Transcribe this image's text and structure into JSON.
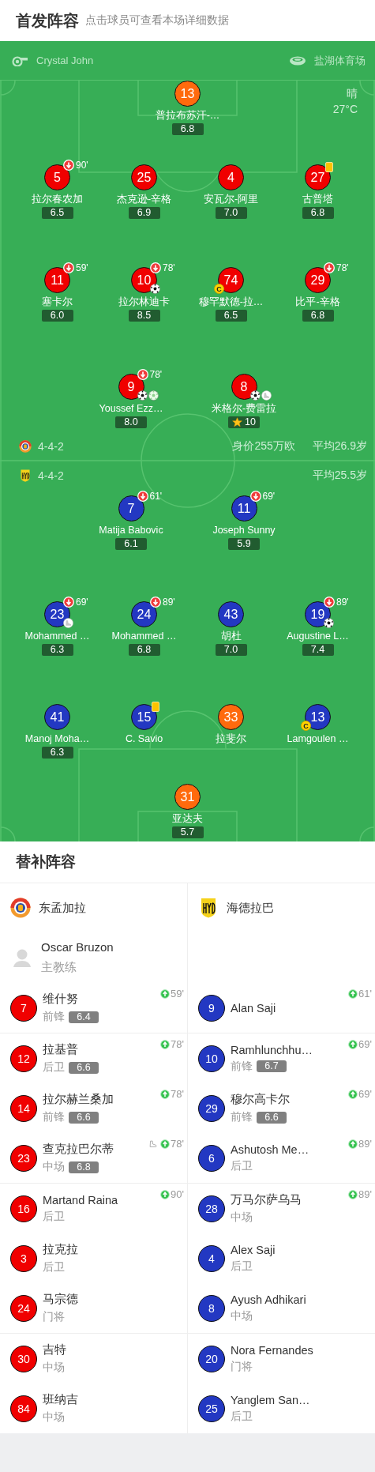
{
  "header": {
    "title": "首发阵容",
    "subtitle": "点击球员可查看本场详细数据"
  },
  "match_info": {
    "referee": "Crystal John",
    "venue": "盐湖体育场",
    "weather": "晴",
    "temperature": "27°C"
  },
  "home": {
    "formation": "4-4-2",
    "value": "身价255万欧",
    "avg_age": "平均26.9岁",
    "lines": [
      {
        "players": [
          {
            "number": "13",
            "name": "普拉布苏汗-…",
            "rating": "6.8",
            "color": "#ff6a0d",
            "yellow_card": false,
            "mvp": false
          }
        ]
      },
      {
        "players": [
          {
            "number": "5",
            "name": "拉尔春农加",
            "rating": "6.5",
            "color": "#f00000",
            "sub_off": "90'",
            "yellow_card": false,
            "mvp": false
          },
          {
            "number": "25",
            "name": "杰克逊-辛格",
            "rating": "6.9",
            "color": "#f00000",
            "yellow_card": false,
            "mvp": false
          },
          {
            "number": "4",
            "name": "安瓦尔-阿里",
            "rating": "7.0",
            "color": "#f00000",
            "yellow_card": false,
            "mvp": false
          },
          {
            "number": "27",
            "name": "古普塔",
            "rating": "6.8",
            "color": "#f00000",
            "yellow_card": true,
            "mvp": false
          }
        ]
      },
      {
        "players": [
          {
            "number": "11",
            "name": "塞卡尔",
            "rating": "6.0",
            "color": "#f00000",
            "sub_off": "59'",
            "yellow_card": false,
            "mvp": false
          },
          {
            "number": "10",
            "name": "拉尔林迪卡",
            "rating": "8.5",
            "color": "#f00000",
            "sub_off": "78'",
            "yellow_card": false,
            "mvp": false,
            "events": [
              {
                "kind": "goal"
              }
            ]
          },
          {
            "number": "74",
            "name": "穆罕默德-拉…",
            "rating": "6.5",
            "color": "#f00000",
            "captain_badge": "C",
            "yellow_card": false,
            "mvp": false
          },
          {
            "number": "29",
            "name": "比平-辛格",
            "rating": "6.8",
            "color": "#f00000",
            "sub_off": "78'",
            "yellow_card": false,
            "mvp": false
          }
        ]
      },
      {
        "players": [
          {
            "number": "9",
            "name": "Youssef Ezz…",
            "rating": "8.0",
            "color": "#f00000",
            "sub_off": "78'",
            "yellow_card": false,
            "mvp": false,
            "events": [
              {
                "kind": "goal"
              },
              {
                "kind": "penalty_goal"
              }
            ]
          },
          {
            "number": "8",
            "name": "米格尔-费雷拉",
            "rating": "10",
            "color": "#f00000",
            "yellow_card": false,
            "mvp": true,
            "events": [
              {
                "kind": "goal"
              },
              {
                "kind": "assist"
              }
            ]
          }
        ]
      }
    ]
  },
  "away": {
    "formation": "4-4-2",
    "avg_age": "平均25.5岁",
    "lines": [
      {
        "players": [
          {
            "number": "7",
            "name": "Matija Babovic",
            "rating": "6.1",
            "color": "#2338c2",
            "sub_off": "61'",
            "yellow_card": false,
            "mvp": false
          },
          {
            "number": "11",
            "name": "Joseph Sunny",
            "rating": "5.9",
            "color": "#2338c2",
            "sub_off": "69'",
            "yellow_card": false,
            "mvp": false
          }
        ]
      },
      {
        "players": [
          {
            "number": "23",
            "name": "Mohammed …",
            "rating": "6.3",
            "color": "#2338c2",
            "sub_off": "69'",
            "yellow_card": false,
            "mvp": false,
            "events": [
              {
                "kind": "assist"
              }
            ]
          },
          {
            "number": "24",
            "name": "Mohammed …",
            "rating": "6.8",
            "color": "#2338c2",
            "sub_off": "89'",
            "yellow_card": false,
            "mvp": false
          },
          {
            "number": "43",
            "name": "胡杜",
            "rating": "7.0",
            "color": "#2338c2",
            "yellow_card": false,
            "mvp": false
          },
          {
            "number": "19",
            "name": "Augustine L…",
            "rating": "7.4",
            "color": "#2338c2",
            "sub_off": "89'",
            "yellow_card": false,
            "mvp": false,
            "events": [
              {
                "kind": "goal"
              }
            ]
          }
        ]
      },
      {
        "players": [
          {
            "number": "41",
            "name": "Manoj Moha…",
            "rating": "6.3",
            "color": "#2338c2",
            "yellow_card": false,
            "mvp": false
          },
          {
            "number": "15",
            "name": "C. Savio",
            "color": "#2338c2",
            "yellow_card": true,
            "mvp": false
          },
          {
            "number": "33",
            "name": "拉斐尔",
            "color": "#ff6a0d",
            "yellow_card": false,
            "mvp": false
          },
          {
            "number": "13",
            "name": "Lamgoulen …",
            "color": "#2338c2",
            "captain_badge": "C",
            "yellow_card": false,
            "mvp": false
          }
        ]
      },
      {
        "players": [
          {
            "number": "31",
            "name": "亚达夫",
            "rating": "5.7",
            "color": "#ff6a0d",
            "yellow_card": false,
            "mvp": false
          }
        ]
      }
    ]
  },
  "subs": {
    "title": "替补阵容",
    "home_team": "东孟加拉",
    "away_team": "海德拉巴",
    "coach": {
      "name": "Oscar Bruzon",
      "role": "主教练"
    },
    "groups": [
      [
        {
          "home": {
            "number": "7",
            "name": "维什努",
            "position": "前锋",
            "rating": "6.4",
            "color": "#f00000",
            "sub_on": "59'"
          },
          "away": {
            "number": "9",
            "name": "Alan Saji",
            "color": "#2338c2",
            "sub_on": "61'"
          }
        }
      ],
      [
        {
          "home": {
            "number": "12",
            "name": "拉基普",
            "position": "后卫",
            "rating": "6.6",
            "color": "#f00000",
            "sub_on": "78'"
          },
          "away": {
            "number": "10",
            "name": "Ramhlunchhu…",
            "position": "前锋",
            "rating": "6.7",
            "color": "#2338c2",
            "sub_on": "69'"
          }
        },
        {
          "home": {
            "number": "14",
            "name": "拉尔赫兰桑加",
            "position": "前锋",
            "rating": "6.6",
            "color": "#f00000",
            "sub_on": "78'"
          },
          "away": {
            "number": "29",
            "name": "穆尔高卡尔",
            "position": "前锋",
            "rating": "6.6",
            "color": "#2338c2",
            "sub_on": "69'"
          }
        },
        {
          "home": {
            "number": "23",
            "name": "查克拉巴尔蒂",
            "position": "中场",
            "rating": "6.8",
            "color": "#f00000",
            "sub_on": "78'",
            "events": [
              {
                "kind": "assist"
              }
            ]
          },
          "away": {
            "number": "6",
            "name": "Ashutosh Me…",
            "position": "后卫",
            "color": "#2338c2",
            "sub_on": "89'"
          }
        }
      ],
      [
        {
          "home": {
            "number": "16",
            "name": "Martand Raina",
            "position": "后卫",
            "color": "#f00000",
            "sub_on": "90'"
          },
          "away": {
            "number": "28",
            "name": "万马尔萨乌马",
            "position": "中场",
            "color": "#2338c2",
            "sub_on": "89'"
          }
        },
        {
          "home": {
            "number": "3",
            "name": "拉克拉",
            "position": "后卫",
            "color": "#f00000"
          },
          "away": {
            "number": "4",
            "name": "Alex Saji",
            "position": "后卫",
            "color": "#2338c2"
          }
        },
        {
          "home": {
            "number": "24",
            "name": "马宗德",
            "position": "门将",
            "color": "#f00000"
          },
          "away": {
            "number": "8",
            "name": "Ayush Adhikari",
            "position": "中场",
            "color": "#2338c2"
          }
        }
      ],
      [
        {
          "home": {
            "number": "30",
            "name": "吉特",
            "position": "中场",
            "color": "#f00000"
          },
          "away": {
            "number": "20",
            "name": "Nora Fernandes",
            "position": "门将",
            "color": "#2338c2"
          }
        },
        {
          "home": {
            "number": "84",
            "name": "班纳吉",
            "position": "中场",
            "color": "#f00000"
          },
          "away": {
            "number": "25",
            "name": "Yanglem San…",
            "position": "后卫",
            "color": "#2338c2"
          }
        }
      ]
    ]
  }
}
